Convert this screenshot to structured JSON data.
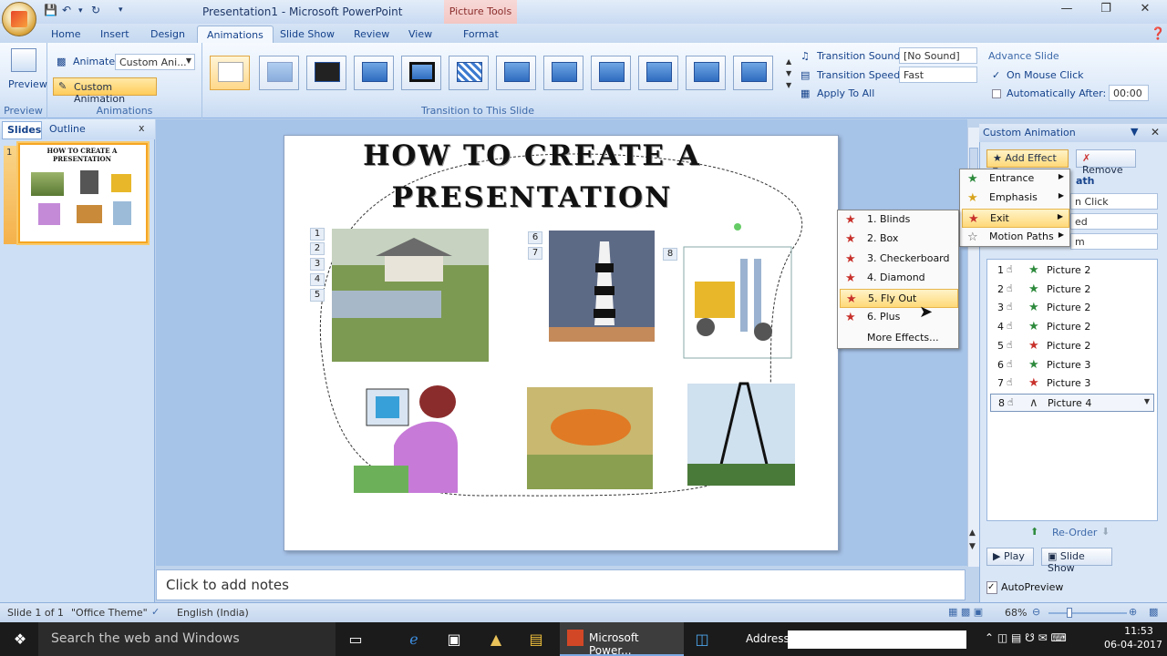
{
  "title_bar": {
    "title": "Presentation1 - Microsoft PowerPoint",
    "context_tab": "Picture Tools"
  },
  "tabs": [
    "Home",
    "Insert",
    "Design",
    "Animations",
    "Slide Show",
    "Review",
    "View",
    "Format"
  ],
  "ribbon": {
    "preview_label": "Preview",
    "preview_group": "Preview",
    "animate_label": "Animate:",
    "animate_value": "Custom Ani...",
    "custom_animation_btn": "Custom Animation",
    "animations_group": "Animations",
    "transition_group": "Transition to This Slide",
    "transition_sound_label": "Transition Sound:",
    "transition_sound_value": "[No Sound]",
    "transition_speed_label": "Transition Speed:",
    "transition_speed_value": "Fast",
    "apply_to_all": "Apply To All",
    "advance_slide": "Advance Slide",
    "on_mouse_click": "On Mouse Click",
    "auto_after": "Automatically After:",
    "auto_after_value": "00:00"
  },
  "left_pane": {
    "tab_slides": "Slides",
    "tab_outline": "Outline",
    "close": "x",
    "slide_number": "1",
    "thumb_title": "HOW TO CREATE A PRESENTATION"
  },
  "slide": {
    "title": "HOW TO CREATE A PRESENTATION",
    "tags": [
      "1",
      "2",
      "3",
      "4",
      "5",
      "6",
      "7",
      "8"
    ]
  },
  "notes": "Click to add notes",
  "status": {
    "slide": "Slide 1 of 1",
    "theme": "\"Office Theme\"",
    "language": "English (India)",
    "zoom": "68%"
  },
  "custom_animation": {
    "title": "Custom Animation",
    "add_effect": "Add Effect",
    "remove": "Remove",
    "partial_path": "ath",
    "partial_start": "n Click",
    "partial_dir": "ed",
    "partial_speed": "m",
    "items": [
      {
        "n": "1",
        "name": "Picture 2",
        "icon": "star-entrance",
        "color": "#2d8a3c"
      },
      {
        "n": "2",
        "name": "Picture 2",
        "icon": "star-entrance",
        "color": "#2d8a3c"
      },
      {
        "n": "3",
        "name": "Picture 2",
        "icon": "star-entrance",
        "color": "#2d8a3c"
      },
      {
        "n": "4",
        "name": "Picture 2",
        "icon": "star-entrance",
        "color": "#2d8a3c"
      },
      {
        "n": "5",
        "name": "Picture 2",
        "icon": "star-exit",
        "color": "#c8312b"
      },
      {
        "n": "6",
        "name": "Picture 3",
        "icon": "star-entrance",
        "color": "#2d8a3c"
      },
      {
        "n": "7",
        "name": "Picture 3",
        "icon": "star-exit",
        "color": "#c8312b"
      },
      {
        "n": "8",
        "name": "Picture 4",
        "icon": "motion-path",
        "color": "#333333"
      }
    ],
    "reorder": "Re-Order",
    "play": "Play",
    "slide_show": "Slide Show",
    "autopreview": "AutoPreview"
  },
  "add_effect_menu": [
    "Entrance",
    "Emphasis",
    "Exit",
    "Motion Paths"
  ],
  "exit_submenu": [
    "1. Blinds",
    "2. Box",
    "3. Checkerboard",
    "4. Diamond",
    "5. Fly Out",
    "6. Plus",
    "More Effects..."
  ],
  "taskbar": {
    "search": "Search the web and Windows",
    "app": "Microsoft Power...",
    "address": "Address",
    "time": "11:53",
    "date": "06-04-2017"
  }
}
